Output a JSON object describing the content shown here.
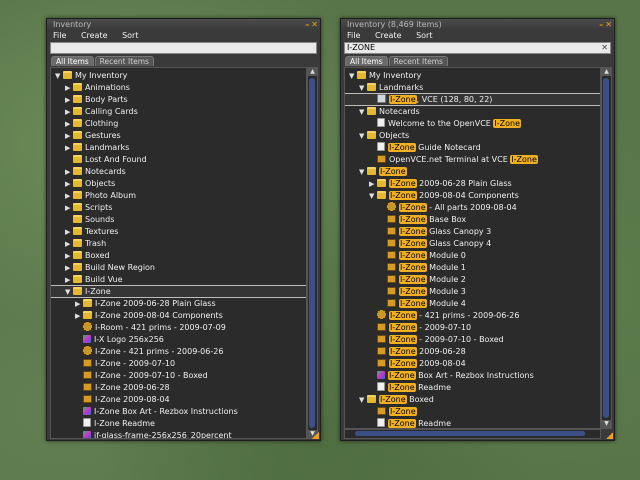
{
  "left": {
    "title": "Inventory",
    "menu": [
      "File",
      "Create",
      "Sort"
    ],
    "search_value": "",
    "tabs": [
      "All Items",
      "Recent Items"
    ],
    "rows": [
      {
        "t": "My Inventory",
        "a": "down",
        "i": "folder",
        "d": 0
      },
      {
        "t": "Animations",
        "a": "right",
        "i": "folder",
        "d": 1
      },
      {
        "t": "Body Parts",
        "a": "right",
        "i": "folder",
        "d": 1
      },
      {
        "t": "Calling Cards",
        "a": "right",
        "i": "folder",
        "d": 1
      },
      {
        "t": "Clothing",
        "a": "right",
        "i": "folder",
        "d": 1
      },
      {
        "t": "Gestures",
        "a": "right",
        "i": "folder",
        "d": 1
      },
      {
        "t": "Landmarks",
        "a": "right",
        "i": "folder",
        "d": 1
      },
      {
        "t": "Lost And Found",
        "a": "",
        "i": "folder",
        "d": 1
      },
      {
        "t": "Notecards",
        "a": "right",
        "i": "folder",
        "d": 1
      },
      {
        "t": "Objects",
        "a": "right",
        "i": "folder",
        "d": 1
      },
      {
        "t": "Photo Album",
        "a": "right",
        "i": "folder",
        "d": 1
      },
      {
        "t": "Scripts",
        "a": "right",
        "i": "folder",
        "d": 1
      },
      {
        "t": "Sounds",
        "a": "",
        "i": "folder",
        "d": 1
      },
      {
        "t": "Textures",
        "a": "right",
        "i": "folder",
        "d": 1
      },
      {
        "t": "Trash",
        "a": "right",
        "i": "folder",
        "d": 1
      },
      {
        "t": "Boxed",
        "a": "right",
        "i": "folder",
        "d": 1
      },
      {
        "t": "Build New Region",
        "a": "right",
        "i": "folder",
        "d": 1
      },
      {
        "t": "Build Vue",
        "a": "right",
        "i": "folder",
        "d": 1
      },
      {
        "t": "I-Zone",
        "a": "down",
        "i": "folder",
        "d": 1,
        "sel": true
      },
      {
        "t": "I-Zone 2009-06-28 Plain Glass",
        "a": "right",
        "i": "folder",
        "d": 2
      },
      {
        "t": "I-Zone 2009-08-04 Components",
        "a": "right",
        "i": "folder",
        "d": 2
      },
      {
        "t": "I-Room - 421 prims - 2009-07-09",
        "a": "",
        "i": "multi",
        "d": 2
      },
      {
        "t": "I-X Logo 256x256",
        "a": "",
        "i": "tex",
        "d": 2
      },
      {
        "t": "I-Zone - 421 prims - 2009-06-26",
        "a": "",
        "i": "multi",
        "d": 2
      },
      {
        "t": "I-Zone - 2009-07-10",
        "a": "",
        "i": "obj",
        "d": 2
      },
      {
        "t": "I-Zone - 2009-07-10 - Boxed",
        "a": "",
        "i": "obj",
        "d": 2
      },
      {
        "t": "I-Zone 2009-06-28",
        "a": "",
        "i": "obj",
        "d": 2
      },
      {
        "t": "I-Zone 2009-08-04",
        "a": "",
        "i": "obj",
        "d": 2
      },
      {
        "t": "I-Zone Box Art - Rezbox Instructions",
        "a": "",
        "i": "tex",
        "d": 2
      },
      {
        "t": "I-Zone Readme",
        "a": "",
        "i": "note",
        "d": 2
      },
      {
        "t": "if-glass-frame-256x256_20percent",
        "a": "",
        "i": "tex",
        "d": 2
      }
    ]
  },
  "right": {
    "title": "Inventory (8,469 items)",
    "menu": [
      "File",
      "Create",
      "Sort"
    ],
    "search_value": "I-ZONE",
    "tabs": [
      "All Items",
      "Recent Items"
    ],
    "rows": [
      {
        "t": "My Inventory",
        "a": "down",
        "i": "folder",
        "d": 0
      },
      {
        "t": "Landmarks",
        "a": "down",
        "i": "folder",
        "d": 1
      },
      {
        "t": "I-Zone, VCE (128, 80, 22)",
        "a": "",
        "i": "lm",
        "d": 2,
        "sel": true,
        "h": "I-Zone",
        "rest": ", VCE (128, 80, 22)"
      },
      {
        "t": "Notecards",
        "a": "down",
        "i": "folder",
        "d": 1
      },
      {
        "t": "Welcome to the OpenVCE I-Zone",
        "a": "",
        "i": "note",
        "d": 2,
        "pre": "Welcome to the OpenVCE ",
        "h": "I-Zone",
        "rest": ""
      },
      {
        "t": "Objects",
        "a": "down",
        "i": "folder",
        "d": 1
      },
      {
        "t": "I-Zone Guide Notecard",
        "a": "",
        "i": "note",
        "d": 2,
        "h": "I-Zone",
        "rest": " Guide Notecard"
      },
      {
        "t": "OpenVCE.net Terminal at VCE I-Zone",
        "a": "",
        "i": "obj",
        "d": 2,
        "pre": "OpenVCE.net Terminal at VCE ",
        "h": "I-Zone",
        "rest": ""
      },
      {
        "t": "I-Zone",
        "a": "down",
        "i": "folder",
        "d": 1,
        "h": "I-Zone",
        "rest": ""
      },
      {
        "t": "I-Zone 2009-06-28 Plain Glass",
        "a": "right",
        "i": "folder",
        "d": 2,
        "h": "I-Zone",
        "rest": " 2009-06-28 Plain Glass"
      },
      {
        "t": "I-Zone 2009-08-04 Components",
        "a": "down",
        "i": "folder",
        "d": 2,
        "h": "I-Zone",
        "rest": " 2009-08-04 Components"
      },
      {
        "t": "I-Zone - All parts 2009-08-04",
        "a": "",
        "i": "multi",
        "d": 3,
        "h": "I-Zone",
        "rest": " - All parts 2009-08-04"
      },
      {
        "t": "I-Zone Base Box",
        "a": "",
        "i": "obj",
        "d": 3,
        "h": "I-Zone",
        "rest": " Base Box"
      },
      {
        "t": "I-Zone Glass Canopy 3",
        "a": "",
        "i": "obj",
        "d": 3,
        "h": "I-Zone",
        "rest": " Glass Canopy 3"
      },
      {
        "t": "I-Zone Glass Canopy 4",
        "a": "",
        "i": "obj",
        "d": 3,
        "h": "I-Zone",
        "rest": " Glass Canopy 4"
      },
      {
        "t": "I-Zone Module 0",
        "a": "",
        "i": "obj",
        "d": 3,
        "h": "I-Zone",
        "rest": " Module 0"
      },
      {
        "t": "I-Zone Module 1",
        "a": "",
        "i": "obj",
        "d": 3,
        "h": "I-Zone",
        "rest": " Module 1"
      },
      {
        "t": "I-Zone Module 2",
        "a": "",
        "i": "obj",
        "d": 3,
        "h": "I-Zone",
        "rest": " Module 2"
      },
      {
        "t": "I-Zone Module 3",
        "a": "",
        "i": "obj",
        "d": 3,
        "h": "I-Zone",
        "rest": " Module 3"
      },
      {
        "t": "I-Zone Module 4",
        "a": "",
        "i": "obj",
        "d": 3,
        "h": "I-Zone",
        "rest": " Module 4"
      },
      {
        "t": "I-Zone - 421 prims - 2009-06-26",
        "a": "",
        "i": "multi",
        "d": 2,
        "h": "I-Zone",
        "rest": " - 421 prims - 2009-06-26"
      },
      {
        "t": "I-Zone - 2009-07-10",
        "a": "",
        "i": "obj",
        "d": 2,
        "h": "I-Zone",
        "rest": " - 2009-07-10"
      },
      {
        "t": "I-Zone - 2009-07-10 - Boxed",
        "a": "",
        "i": "obj",
        "d": 2,
        "h": "I-Zone",
        "rest": " - 2009-07-10 - Boxed"
      },
      {
        "t": "I-Zone 2009-06-28",
        "a": "",
        "i": "obj",
        "d": 2,
        "h": "I-Zone",
        "rest": " 2009-06-28"
      },
      {
        "t": "I-Zone 2009-08-04",
        "a": "",
        "i": "obj",
        "d": 2,
        "h": "I-Zone",
        "rest": " 2009-08-04"
      },
      {
        "t": "I-Zone Box Art - Rezbox Instructions",
        "a": "",
        "i": "tex",
        "d": 2,
        "h": "I-Zone",
        "rest": " Box Art - Rezbox Instructions"
      },
      {
        "t": "I-Zone Readme",
        "a": "",
        "i": "note",
        "d": 2,
        "h": "I-Zone",
        "rest": " Readme"
      },
      {
        "t": "I-Zone Boxed",
        "a": "down",
        "i": "folder",
        "d": 1,
        "h": "I-Zone",
        "rest": " Boxed"
      },
      {
        "t": "I-Zone",
        "a": "",
        "i": "obj",
        "d": 2,
        "h": "I-Zone",
        "rest": ""
      },
      {
        "t": "I-Zone Readme",
        "a": "",
        "i": "note",
        "d": 2,
        "h": "I-Zone",
        "rest": " Readme"
      }
    ]
  },
  "icons": {
    "minimize": "minimize-icon",
    "close": "close-icon",
    "clear": "clear-search-icon"
  },
  "colors": {
    "highlight": "#f0b020",
    "accent": "#f0a020",
    "scroll_thumb": "#3c4f86"
  }
}
